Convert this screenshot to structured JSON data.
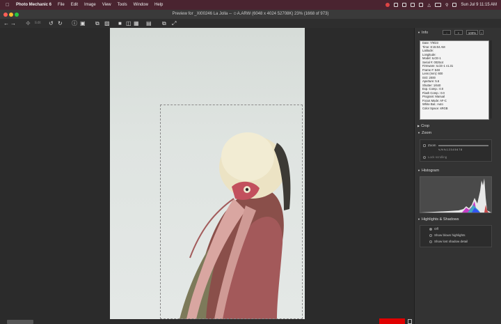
{
  "menubar": {
    "app_name": "Photo Mechanic 6",
    "items": [
      "File",
      "Edit",
      "Image",
      "View",
      "Tools",
      "Window",
      "Help"
    ],
    "clock": "Sun Jul 9 11:15 AM"
  },
  "window": {
    "title": "Preview for _XI00246 La Jolla -- ☺A.ARW (6048 x 4024 52708K) 23% (1668 of 973)"
  },
  "toolbar": {
    "edit_label": "Edit"
  },
  "panel": {
    "info": {
      "header": "Info",
      "zoom_value": "100%",
      "minus_label": "-",
      "plus_label": "+",
      "lines": [
        "Date: 7/9/23",
        "Time: 8:15:04 AM",
        "Latitude:",
        "Longitude:",
        "Model: ILCE-1",
        "Serial #: 0025c4",
        "Firmware: ILCE-1 v1.31",
        "Frame #: 548",
        "Lens (mm): 600",
        "ISO: 2000",
        "Aperture: 5.6",
        "Shutter: 1/640",
        "Exp. Comp.: 0.0",
        "Flash Comp.: 0.0",
        "Program: Manual",
        "Focus Mode: AF-C",
        "White Bal.: Auto",
        "Color Space: sRGB"
      ]
    },
    "crop": {
      "header": "Crop"
    },
    "zoom": {
      "header": "Zoom",
      "zoom_label": "Zoom",
      "lock_label": "Lock scrolling",
      "scale_labels": "¼ ½ ⅛ 1 2 3 4 5 6 7 8"
    },
    "histogram": {
      "header": "Histogram"
    },
    "highlights": {
      "header": "Highlights & Shadows",
      "options": [
        "Off",
        "Show blown highlights",
        "Show lost shadow detail"
      ]
    }
  },
  "colors": {
    "menubar_bg": "#4a2430",
    "close": "#ff5f57",
    "minimize": "#febc2e",
    "zoom": "#28c840",
    "status_red": "#e00000"
  },
  "icons": [
    "apple-icon",
    "arrow-left-icon",
    "arrow-right-icon",
    "move-icon",
    "rotate-left-icon",
    "rotate-right-icon",
    "info-icon",
    "tag-icon",
    "copy-icon",
    "trash-icon",
    "layout-icon",
    "crop-icon",
    "fullscreen-icon"
  ]
}
